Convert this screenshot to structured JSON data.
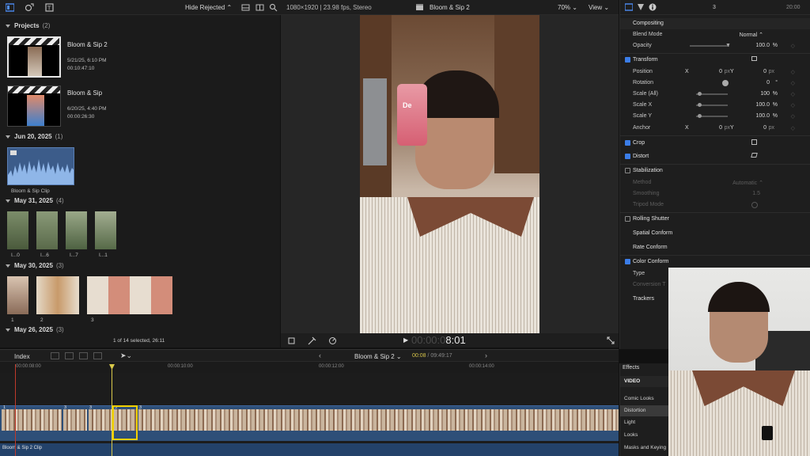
{
  "toolbar": {
    "filter_label": "Hide Rejected",
    "format_info": "1080×1920 | 23.98 fps, Stereo",
    "project_title": "Bloom & Sip 2",
    "zoom": "70%",
    "view_label": "View"
  },
  "browser": {
    "projects_header": "Projects",
    "projects_count": "(2)",
    "projects": [
      {
        "name": "Bloom & Sip 2",
        "date": "5/21/25, 6:10 PM",
        "duration": "00:10:47:10"
      },
      {
        "name": "Bloom & Sip",
        "date": "6/20/25, 4:40 PM",
        "duration": "00:00:26:30"
      }
    ],
    "groups": [
      {
        "date": "Jun 20, 2025",
        "count": "(1)"
      },
      {
        "date": "May 31, 2025",
        "count": "(4)"
      },
      {
        "date": "May 30, 2025",
        "count": "(3)"
      },
      {
        "date": "May 26, 2025",
        "count": "(3)"
      }
    ],
    "audio_clip_name": "Bloom & Sip Clip",
    "may31_clips": [
      "I...0",
      "I...6",
      "I...7",
      "I...1"
    ],
    "may30_clips": [
      "1",
      "2",
      "3"
    ],
    "selection_status": "1 of 14 selected, 26:11"
  },
  "viewer": {
    "timecode": "00:00:08:01",
    "timecode_dim": "00:00:0",
    "timecode_bright": "8:01",
    "product_text": "De"
  },
  "inspector": {
    "clip_count": "3",
    "duration": "20:00",
    "compositing": "Compositing",
    "blend_mode_label": "Blend Mode",
    "blend_mode_value": "Normal",
    "opacity_label": "Opacity",
    "opacity_value": "100.0",
    "pct": "%",
    "transform": "Transform",
    "position_label": "Position",
    "x_label": "X",
    "y_label": "Y",
    "position_x": "0",
    "position_y": "0",
    "px": "px",
    "rotation_label": "Rotation",
    "rotation_value": "0",
    "deg": "°",
    "scale_all_label": "Scale (All)",
    "scale_all_value": "100",
    "scale_x_label": "Scale X",
    "scale_x_value": "100.0",
    "scale_y_label": "Scale Y",
    "scale_y_value": "100.0",
    "anchor_label": "Anchor",
    "anchor_x": "0",
    "anchor_y": "0",
    "crop": "Crop",
    "distort": "Distort",
    "stabilization": "Stabilization",
    "method_label": "Method",
    "method_value": "Automatic",
    "smoothing_label": "Smoothing",
    "smoothing_value": "1.5",
    "tripod_label": "Tripod Mode",
    "rolling_shutter": "Rolling Shutter",
    "spatial_conform": "Spatial Conform",
    "rate_conform": "Rate Conform",
    "color_conform": "Color Conform",
    "type_label": "Type",
    "conversion_label": "Conversion T",
    "trackers": "Trackers"
  },
  "timeline": {
    "index_label": "Index",
    "project_name": "Bloom & Sip 2",
    "current_time": "00:08",
    "total_time": "09:49:17",
    "ruler_labels": [
      "00:00:08:00",
      "00:00:10:00",
      "00:00:12:00",
      "00:00:14:00"
    ],
    "clip_numbers": [
      "1",
      "3",
      "3",
      "3",
      "3"
    ],
    "audio_clip_label": "Bloom & Sip 2 Clip"
  },
  "effects": {
    "title": "Effects",
    "category": "VIDEO",
    "items": [
      "Comic Looks",
      "Distortion",
      "Light",
      "Looks",
      "Masks and Keying"
    ],
    "selected_index": 1
  }
}
